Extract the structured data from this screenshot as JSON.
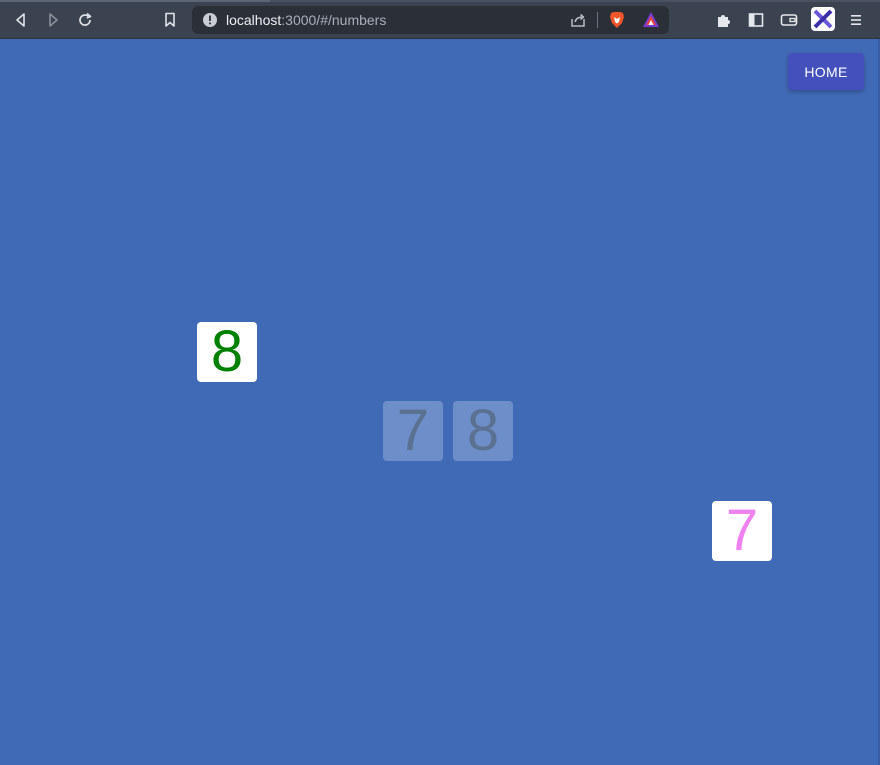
{
  "browser": {
    "url_host": "localhost",
    "url_path": ":3000/#/numbers",
    "icons": {
      "back": "back-arrow-icon",
      "forward": "forward-arrow-icon",
      "reload": "reload-icon",
      "bookmark": "bookmark-icon",
      "site_info": "info-icon",
      "share": "share-icon",
      "brave_shields": "brave-lion-icon",
      "brave_rewards": "brave-rewards-icon",
      "extensions": "puzzle-icon",
      "sidebar": "sidebar-icon",
      "wallet": "wallet-icon",
      "profile_extension": "x-extension-icon",
      "menu": "hamburger-menu-icon"
    }
  },
  "page": {
    "background_color": "#416ab6",
    "home_button": {
      "label": "HOME",
      "color": "#4450bb"
    },
    "target_slots": [
      {
        "digit": "7"
      },
      {
        "digit": "8"
      }
    ],
    "draggable_cards": [
      {
        "digit": "8",
        "color": "#008000"
      },
      {
        "digit": "7",
        "color": "#ee82ee"
      }
    ]
  }
}
